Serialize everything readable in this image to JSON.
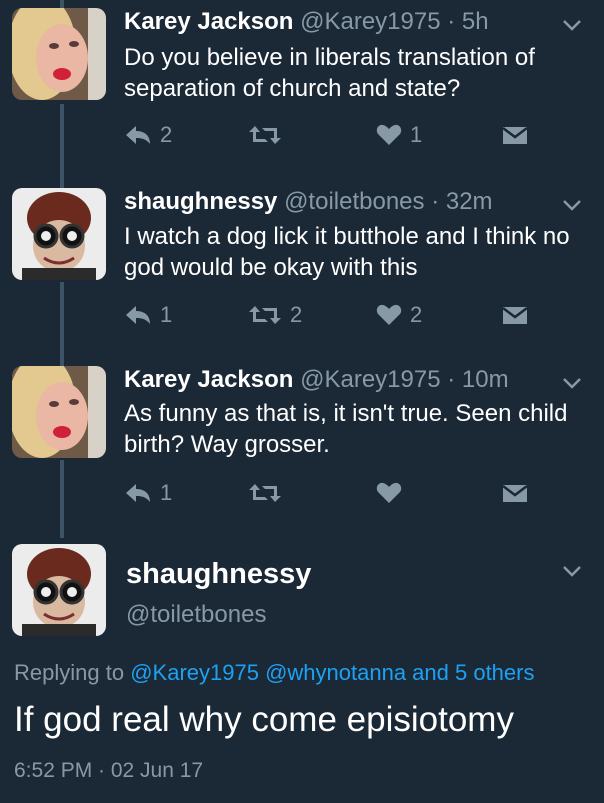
{
  "colors": {
    "background": "#1b2836",
    "secondary_text": "#8899a6",
    "link": "#1da1f2",
    "thread_line": "#3d5466"
  },
  "tweets": [
    {
      "name": "Karey Jackson",
      "handle": "@Karey1975",
      "sep": "·",
      "time": "5h",
      "text": "Do you believe in liberals translation of separation of church and state?",
      "reply_count": "2",
      "retweet_count": "",
      "like_count": "1",
      "avatar_icon": "woman-lips-avatar"
    },
    {
      "name": "shaughnessy",
      "handle": "@toiletbones",
      "sep": "·",
      "time": "32m",
      "text": "I watch a dog lick it butthole and I think no god would be okay with this",
      "reply_count": "1",
      "retweet_count": "2",
      "like_count": "2",
      "avatar_icon": "goggles-helmet-avatar"
    },
    {
      "name": "Karey Jackson",
      "handle": "@Karey1975",
      "sep": "·",
      "time": "10m",
      "text": "As funny as that is, it isn't true. Seen child birth? Way grosser.",
      "reply_count": "1",
      "retweet_count": "",
      "like_count": "",
      "avatar_icon": "woman-lips-avatar"
    }
  ],
  "main_tweet": {
    "name": "shaughnessy",
    "handle": "@toiletbones",
    "replying_prefix": "Replying to",
    "replying_user1": "@Karey1975",
    "replying_user2": "@whynotanna and 5 others",
    "text": "If god real why come episiotomy",
    "timestamp": "6:52 PM · 02 Jun 17",
    "avatar_icon": "goggles-helmet-avatar"
  }
}
